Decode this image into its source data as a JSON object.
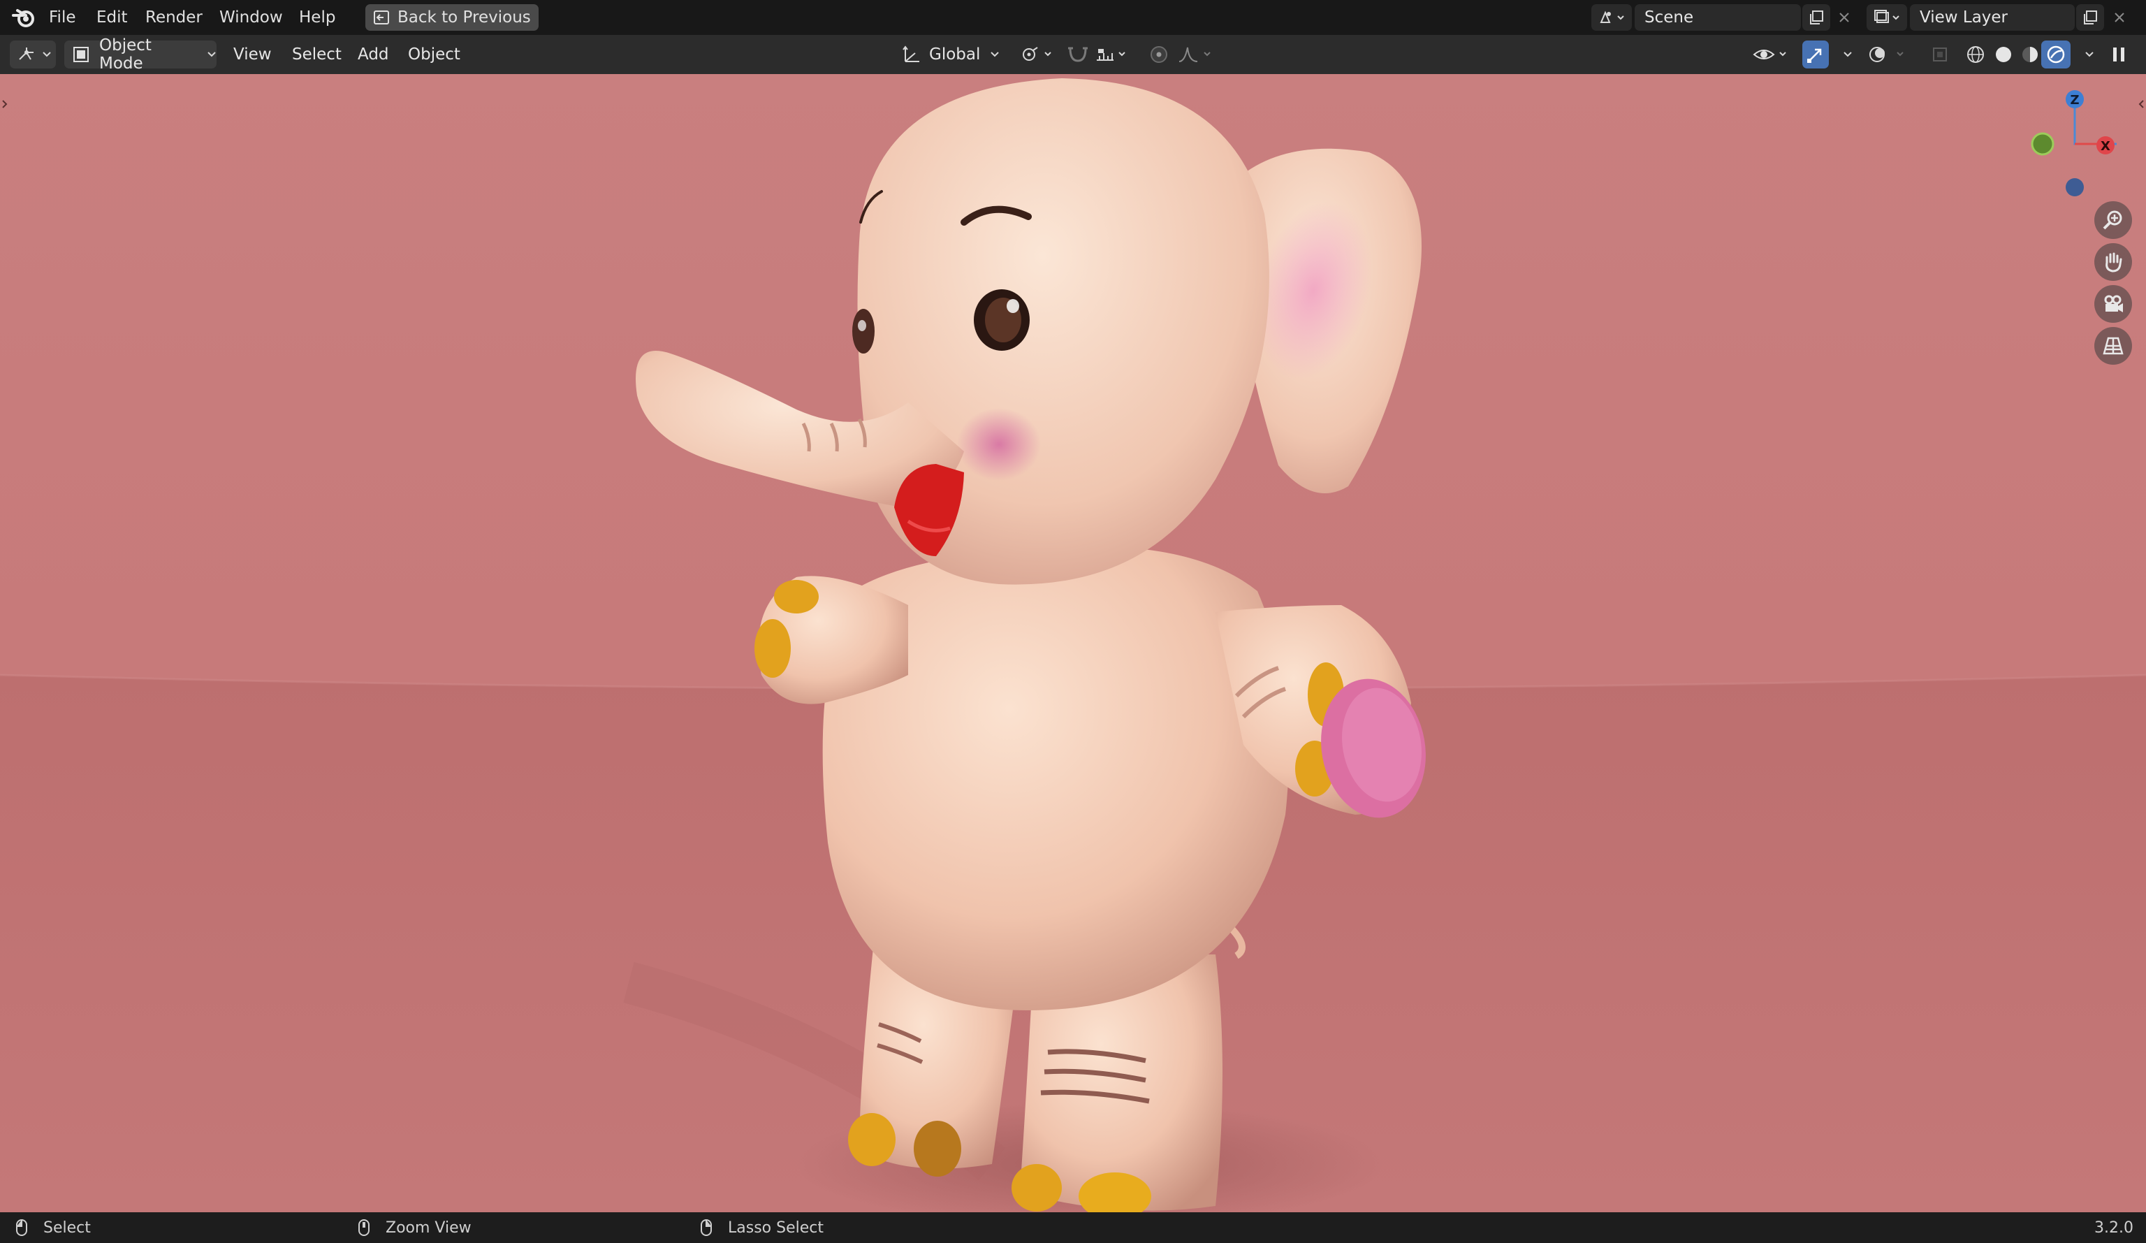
{
  "topbar": {
    "menus": [
      "File",
      "Edit",
      "Render",
      "Window",
      "Help"
    ],
    "back_button": "Back to Previous",
    "scene_name": "Scene",
    "view_layer_name": "View Layer"
  },
  "header": {
    "mode": "Object Mode",
    "menus": [
      "View",
      "Select",
      "Add",
      "Object"
    ],
    "transform_orientation": "Global"
  },
  "gizmo": {
    "axis_z": "Z",
    "axis_x": "X"
  },
  "statusbar": {
    "left_click": "Select",
    "middle_click": "Zoom View",
    "right_click": "Lasso Select",
    "version": "3.2.0"
  },
  "colors": {
    "viewport_bg": "#c77a7a",
    "floor": "#bb6f6f",
    "elephant_body": "#f1c6b0",
    "toe_nails": "#e2a21e",
    "mouth": "#d41d1d",
    "cheek": "#d97aa5",
    "accent_blue": "#4772b3"
  },
  "icons": [
    "blender-logo-icon",
    "back-arrow-icon",
    "scene-icon",
    "copy-icon",
    "close-icon",
    "view-layer-icon",
    "editor-type-icon",
    "object-mode-icon",
    "transform-orientation-icon",
    "pivot-icon",
    "snap-icon",
    "snap-increment-icon",
    "proportional-edit-icon",
    "falloff-icon",
    "visibility-icon",
    "gizmo-icon",
    "overlay-icon",
    "xray-icon",
    "wireframe-shading-icon",
    "solid-shading-icon",
    "material-shading-icon",
    "rendered-shading-icon",
    "zoom-icon",
    "pan-hand-icon",
    "camera-icon",
    "grid-perspective-icon",
    "mouse-left-icon",
    "mouse-middle-icon",
    "mouse-right-icon"
  ]
}
